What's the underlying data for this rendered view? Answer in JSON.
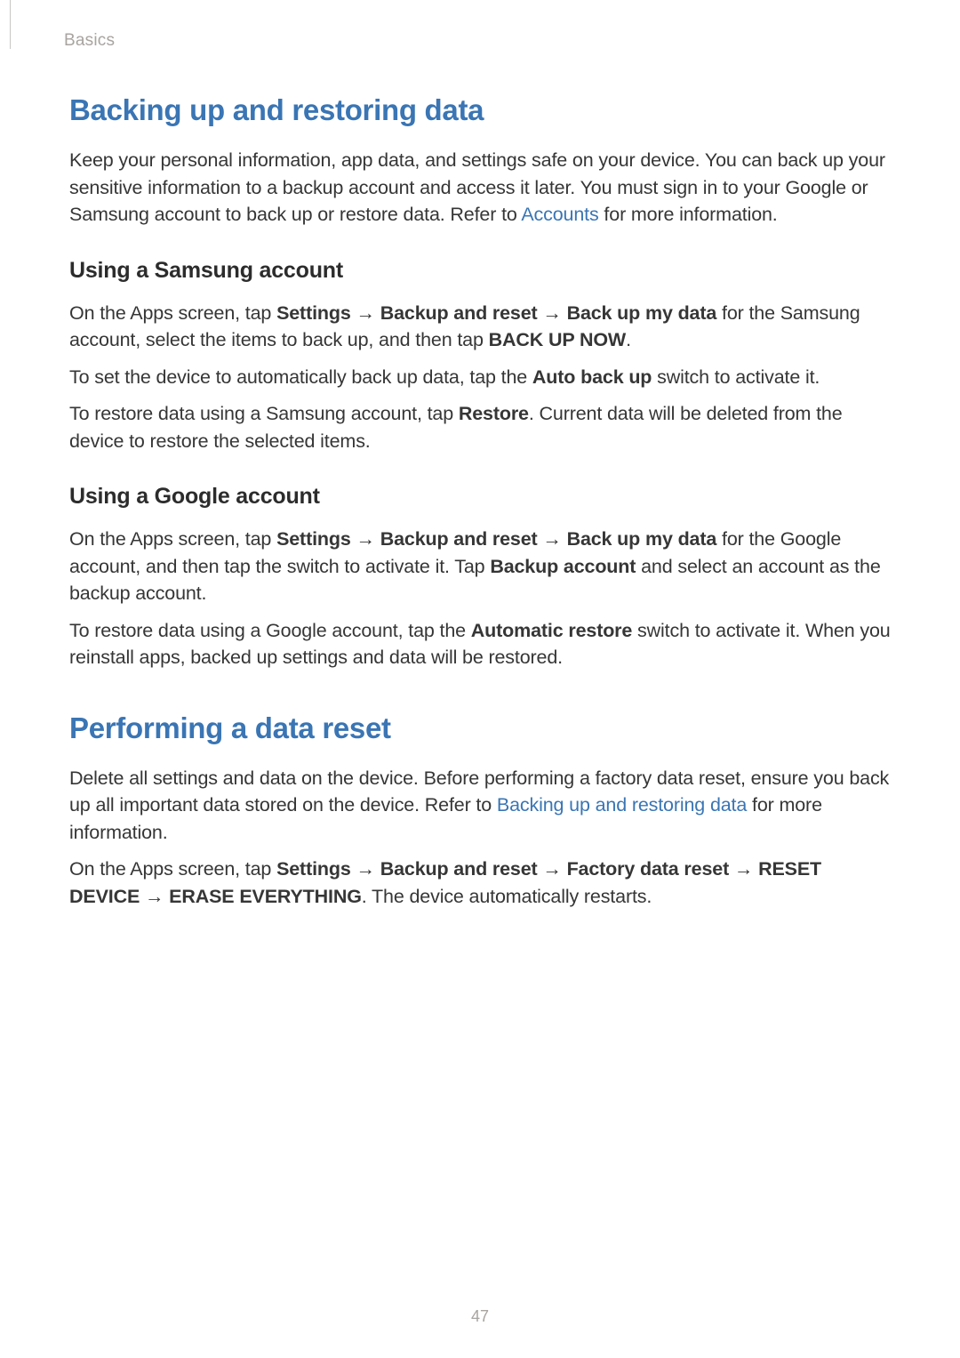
{
  "header": {
    "section": "Basics"
  },
  "s1": {
    "title": "Backing up and restoring data",
    "intro_a": "Keep your personal information, app data, and settings safe on your device. You can back up your sensitive information to a backup account and access it later. You must sign in to your Google or Samsung account to back up or restore data. Refer to ",
    "intro_link": "Accounts",
    "intro_b": " for more information.",
    "sub1": {
      "title": "Using a Samsung account",
      "p1_a": "On the Apps screen, tap ",
      "p1_b1": "Settings",
      "p1_b2": "Backup and reset",
      "p1_b3": "Back up my data",
      "p1_c": " for the Samsung account, select the items to back up, and then tap ",
      "p1_b4": "BACK UP NOW",
      "p1_d": ".",
      "p2_a": "To set the device to automatically back up data, tap the ",
      "p2_b": "Auto back up",
      "p2_c": " switch to activate it.",
      "p3_a": "To restore data using a Samsung account, tap ",
      "p3_b": "Restore",
      "p3_c": ". Current data will be deleted from the device to restore the selected items."
    },
    "sub2": {
      "title": "Using a Google account",
      "p1_a": "On the Apps screen, tap ",
      "p1_b1": "Settings",
      "p1_b2": "Backup and reset",
      "p1_b3": "Back up my data",
      "p1_c": " for the Google account, and then tap the switch to activate it. Tap ",
      "p1_b4": "Backup account",
      "p1_d": " and select an account as the backup account.",
      "p2_a": "To restore data using a Google account, tap the ",
      "p2_b": "Automatic restore",
      "p2_c": " switch to activate it. When you reinstall apps, backed up settings and data will be restored."
    }
  },
  "s2": {
    "title": "Performing a data reset",
    "p1_a": "Delete all settings and data on the device. Before performing a factory data reset, ensure you back up all important data stored on the device. Refer to ",
    "p1_link": "Backing up and restoring data",
    "p1_b": " for more information.",
    "p2_a": "On the Apps screen, tap ",
    "p2_b1": "Settings",
    "p2_b2": "Backup and reset",
    "p2_b3": "Factory data reset",
    "p2_b4": "RESET DEVICE",
    "p2_b5": "ERASE EVERYTHING",
    "p2_c": ". The device automatically restarts."
  },
  "arrow": "→",
  "page_number": "47"
}
